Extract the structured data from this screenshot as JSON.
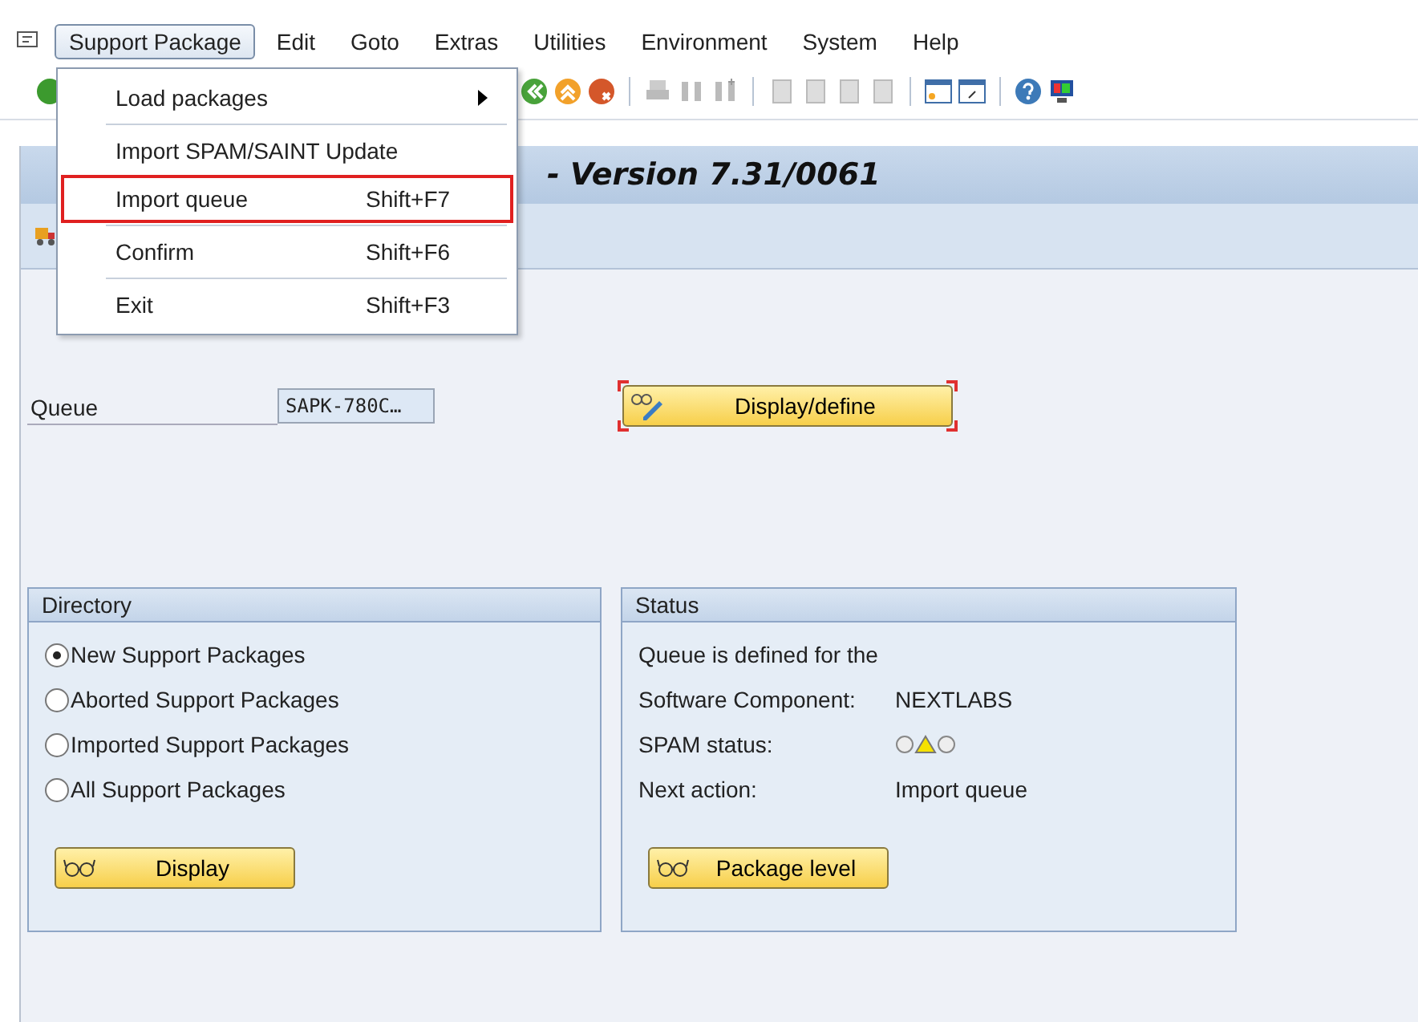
{
  "menubar": [
    {
      "label": "Support Package",
      "selected": true
    },
    {
      "label": "Edit",
      "selected": false
    },
    {
      "label": "Goto",
      "selected": false
    },
    {
      "label": "Extras",
      "selected": false
    },
    {
      "label": "Utilities",
      "selected": false
    },
    {
      "label": "Environment",
      "selected": false
    },
    {
      "label": "System",
      "selected": false
    },
    {
      "label": "Help",
      "selected": false
    }
  ],
  "menu": [
    {
      "label": "Load packages",
      "submenu": true,
      "highlighted": false
    },
    {
      "label": "Import SPAM/SAINT Update",
      "submenu": false,
      "highlighted": false
    },
    {
      "label": "Import queue",
      "shortcut": "Shift+F7",
      "submenu": false,
      "highlighted": true
    },
    {
      "label": "Confirm",
      "shortcut": "Shift+F6",
      "submenu": false,
      "highlighted": false
    },
    {
      "label": "Exit",
      "shortcut": "Shift+F3",
      "submenu": false,
      "highlighted": false
    }
  ],
  "title": "- Version 7.31/0061",
  "queue": {
    "label": "Queue",
    "value": "SAPK-780C…",
    "button": "Display/define",
    "focused": true
  },
  "directory": {
    "title": "Directory",
    "options": [
      {
        "label": "New Support Packages",
        "selected": true
      },
      {
        "label": "Aborted Support Packages",
        "selected": false
      },
      {
        "label": "Imported Support Packages",
        "selected": false
      },
      {
        "label": "All Support Packages",
        "selected": false
      }
    ],
    "button": "Display"
  },
  "status": {
    "title": "Status",
    "rows": [
      {
        "kind": "text",
        "label": "Queue is defined for the"
      },
      {
        "kind": "text",
        "label": "Software Component:",
        "value": "NEXTLABS"
      },
      {
        "kind": "lights",
        "label": "SPAM status:"
      },
      {
        "kind": "text",
        "label": "Next action:",
        "value": "Import queue"
      }
    ],
    "button": "Package level"
  }
}
